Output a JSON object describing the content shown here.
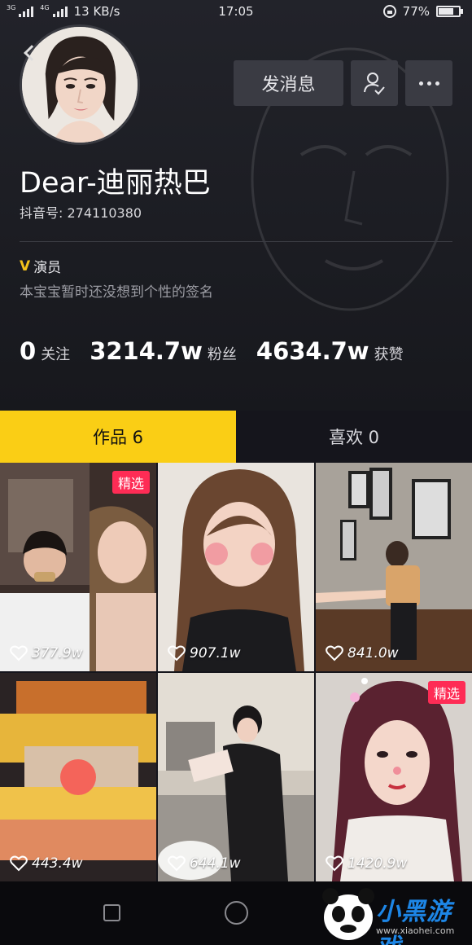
{
  "status_bar": {
    "net1": "3G",
    "net2": "4G",
    "speed": "13 KB/s",
    "time": "17:05",
    "battery": "77%",
    "battery_level": 0.77
  },
  "profile": {
    "name": "Dear-迪丽热巴",
    "douyin_id": "抖音号: 274110380",
    "verify_mark": "V",
    "verify_label": "演员",
    "signature": "本宝宝暂时还没想到个性的签名"
  },
  "actions": {
    "message_label": "发消息",
    "follow_icon": "user-check-icon",
    "more_icon": "more-dots-icon"
  },
  "stats": [
    {
      "value": "0",
      "label": "关注"
    },
    {
      "value": "3214.7w",
      "label": "粉丝"
    },
    {
      "value": "4634.7w",
      "label": "获赞"
    }
  ],
  "tabs": [
    {
      "label": "作品 6",
      "active": true
    },
    {
      "label": "喜欢 0",
      "active": false
    }
  ],
  "videos": [
    {
      "likes": "377.9w",
      "badge": "精选"
    },
    {
      "likes": "907.1w",
      "badge": ""
    },
    {
      "likes": "841.0w",
      "badge": ""
    },
    {
      "likes": "443.4w",
      "badge": ""
    },
    {
      "likes": "644.1w",
      "badge": ""
    },
    {
      "likes": "1420.9w",
      "badge": "精选"
    }
  ],
  "watermark": {
    "text": "小黑游戏",
    "url": "www.xiaohei.com"
  },
  "colors": {
    "accent": "#face15",
    "badge": "#fe2c55",
    "watermark": "#1d86e6"
  }
}
